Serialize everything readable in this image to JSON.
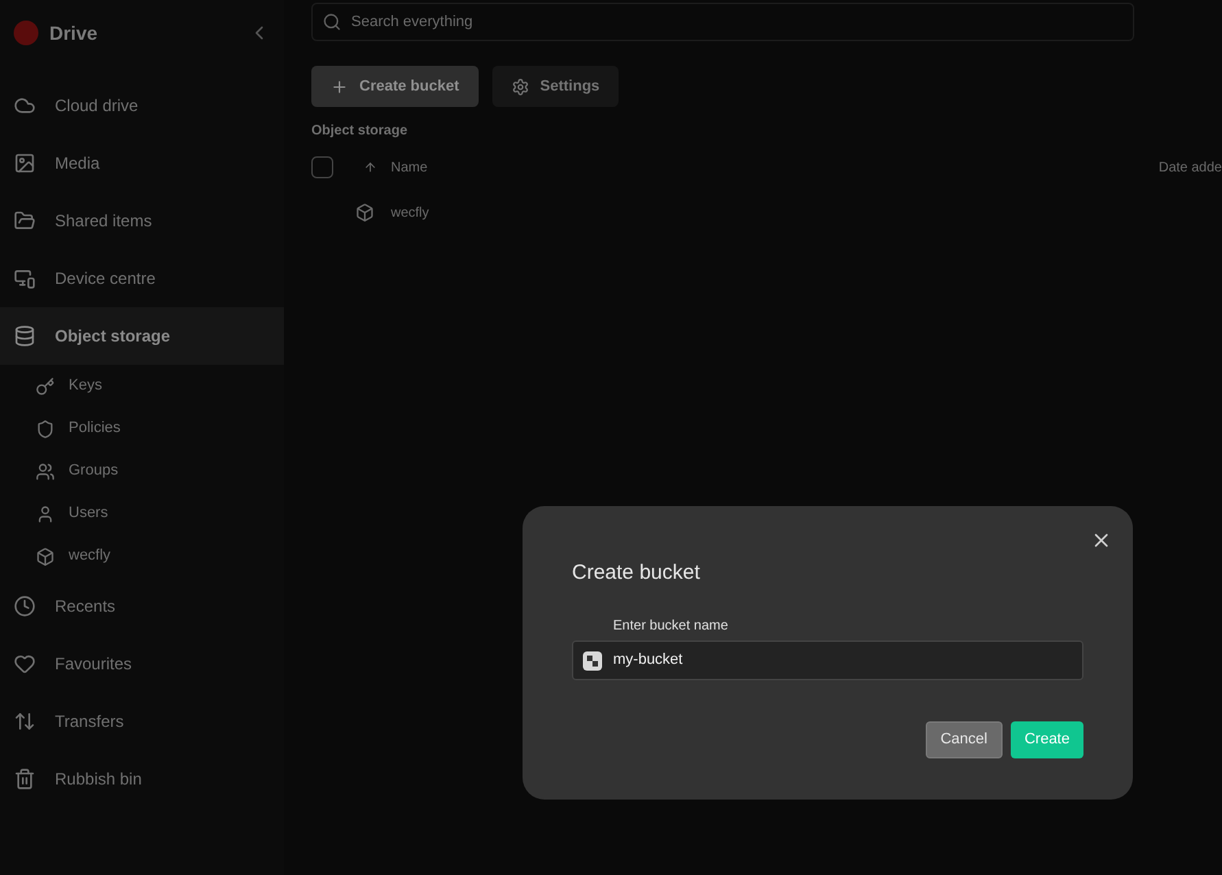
{
  "sidebar": {
    "app_name": "Drive",
    "items": [
      {
        "label": "Cloud drive",
        "selected": false
      },
      {
        "label": "Media",
        "selected": false
      },
      {
        "label": "Shared items",
        "selected": false
      },
      {
        "label": "Device centre",
        "selected": false
      },
      {
        "label": "Object storage",
        "selected": true,
        "children": [
          {
            "label": "Keys"
          },
          {
            "label": "Policies"
          },
          {
            "label": "Groups"
          },
          {
            "label": "Users"
          },
          {
            "label": "wecfly"
          }
        ]
      },
      {
        "label": "Recents",
        "selected": false
      },
      {
        "label": "Favourites",
        "selected": false
      },
      {
        "label": "Transfers",
        "selected": false
      },
      {
        "label": "Rubbish bin",
        "selected": false
      }
    ]
  },
  "search": {
    "placeholder": "Search everything"
  },
  "toolbar": [
    {
      "label": "Create bucket",
      "kind": "primary"
    },
    {
      "label": "Settings",
      "kind": "secondary"
    }
  ],
  "section_title": "Object storage",
  "table": {
    "select_all_checked": false,
    "columns": [
      "Name",
      "Date adde"
    ],
    "rows": [
      {
        "name": "wecfly"
      }
    ]
  },
  "dialog": {
    "title": "Create bucket",
    "field_label": "Enter bucket name",
    "value": "my-bucket",
    "buttons": [
      {
        "label": "Cancel",
        "kind": "secondary"
      },
      {
        "label": "Create",
        "kind": "primary"
      }
    ]
  }
}
